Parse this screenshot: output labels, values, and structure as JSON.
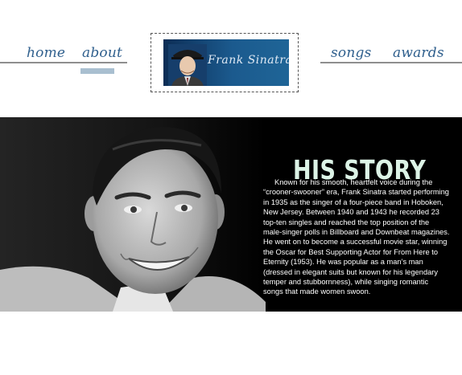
{
  "nav": {
    "home": "home",
    "about": "about",
    "songs": "songs",
    "awards": "awards",
    "active": "about"
  },
  "logo": {
    "signature": "Frank Sinatra"
  },
  "story": {
    "title": "HIS STORY",
    "body": "Known for his smooth, heartfelt voice during the “crooner-swooner” era, Frank Sinatra started performing in 1935 as the singer of a four-piece band in Hoboken, New Jersey. Between 1940 and 1943 he recorded 23 top-ten singles and reached the top position of the male-singer polls in Billboard and Downbeat magazines. He went on to become a successful movie star, winning the Oscar for Best Supporting Actor for From Here to Eternity (1953). He was popular as a man’s man (dressed in elegant suits but known for his legendary temper and stubbornness), while singing romantic songs that made women swoon."
  },
  "colors": {
    "nav_link": "#2f5f8d",
    "active_indicator": "#a9bfd0",
    "title_text": "#dcf3e6",
    "hero_background": "#000000"
  }
}
